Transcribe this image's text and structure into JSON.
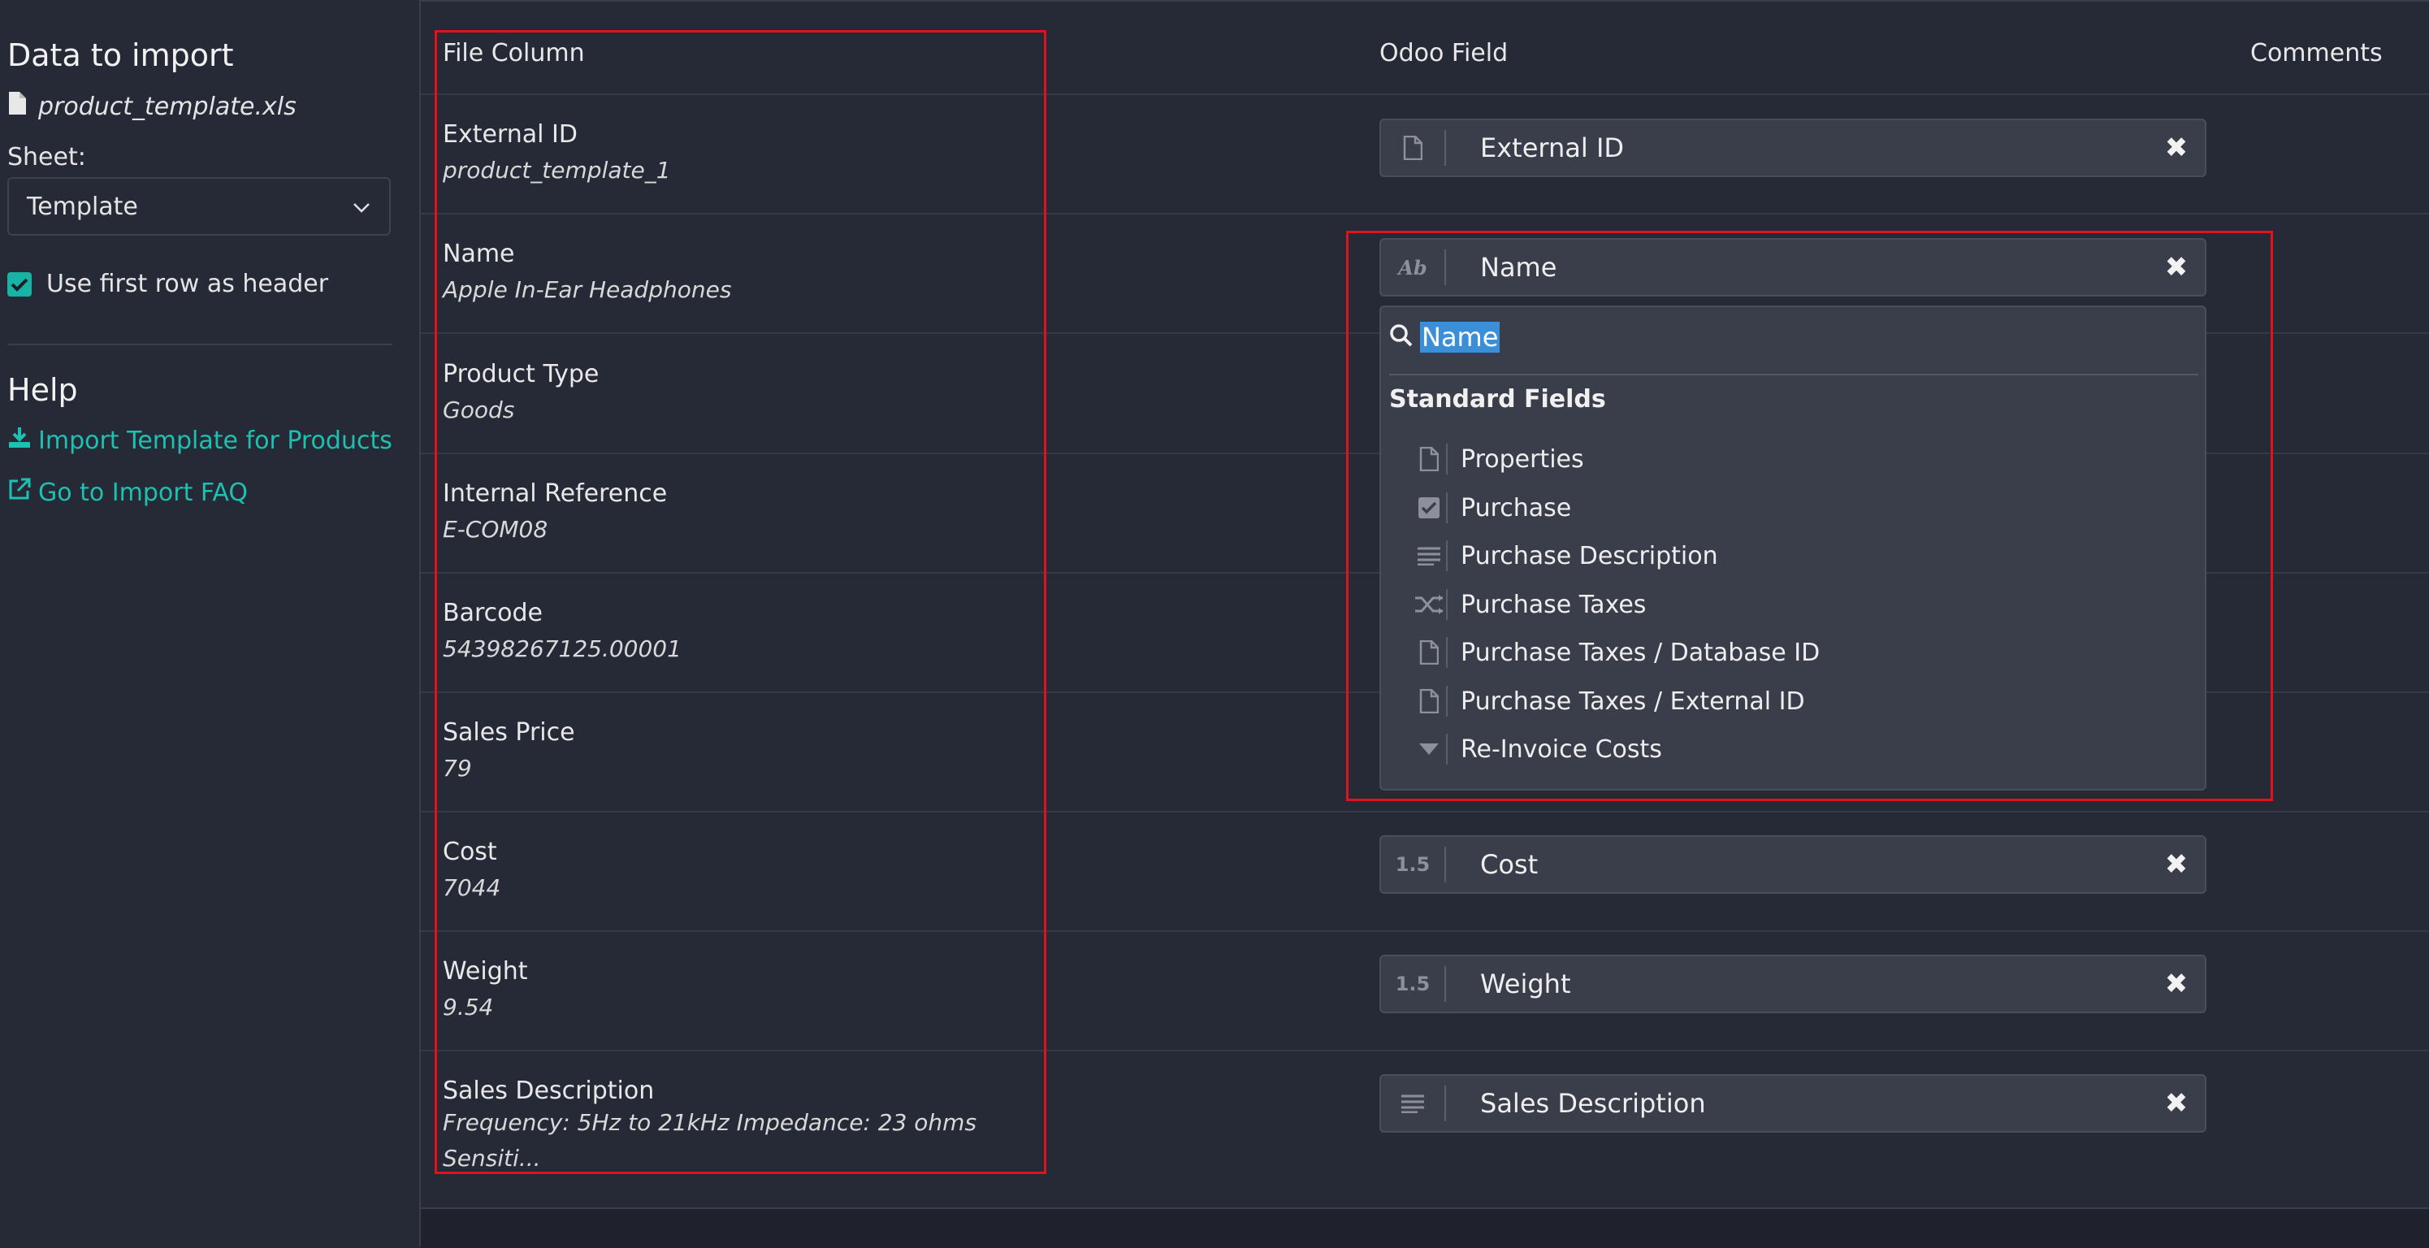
{
  "sidebar": {
    "title": "Data to import",
    "file_name": "product_template.xls",
    "sheet_label": "Sheet:",
    "sheet_value": "Template",
    "header_checkbox_label": "Use first row as header",
    "help_title": "Help",
    "links": [
      "Import Template for Products",
      "Go to Import FAQ"
    ]
  },
  "table": {
    "headers": [
      "File Column",
      "Odoo Field",
      "Comments"
    ],
    "rows": [
      {
        "column": "External ID",
        "sample": "product_template_1",
        "field": "External ID",
        "field_icon": "file-icon"
      },
      {
        "column": "Name",
        "sample": "Apple In-Ear Headphones",
        "field": "Name",
        "field_icon": "text-ab-icon"
      },
      {
        "column": "Product Type",
        "sample": "Goods"
      },
      {
        "column": "Internal Reference",
        "sample": "E-COM08"
      },
      {
        "column": "Barcode",
        "sample": "54398267125.00001"
      },
      {
        "column": "Sales Price",
        "sample": "79"
      },
      {
        "column": "Cost",
        "sample": "7044",
        "field": "Cost",
        "field_icon": "float-icon"
      },
      {
        "column": "Weight",
        "sample": "9.54",
        "field": "Weight",
        "field_icon": "float-icon"
      },
      {
        "column": "Sales Description",
        "sample": "Frequency: 5Hz to 21kHz Impedance: 23 ohms Sensiti...",
        "field": "Sales Description",
        "field_icon": "text-lines-icon"
      }
    ]
  },
  "field_icon_text": {
    "text_ab": "Ab",
    "float": "1.5"
  },
  "dropdown": {
    "search_value": "Name",
    "group_title": "Standard Fields",
    "items": [
      {
        "label": "Properties",
        "icon": "file-icon"
      },
      {
        "label": "Purchase",
        "icon": "checkbox-icon"
      },
      {
        "label": "Purchase Description",
        "icon": "text-lines-icon"
      },
      {
        "label": "Purchase Taxes",
        "icon": "shuffle-icon"
      },
      {
        "label": "Purchase Taxes / Database ID",
        "icon": "file-icon"
      },
      {
        "label": "Purchase Taxes / External ID",
        "icon": "file-icon"
      },
      {
        "label": "Re-Invoice Costs",
        "icon": "caret-down-icon"
      }
    ]
  },
  "colors": {
    "accent": "#1ec0b1",
    "highlight": "#e0131d",
    "selection": "#3b8fd8"
  }
}
